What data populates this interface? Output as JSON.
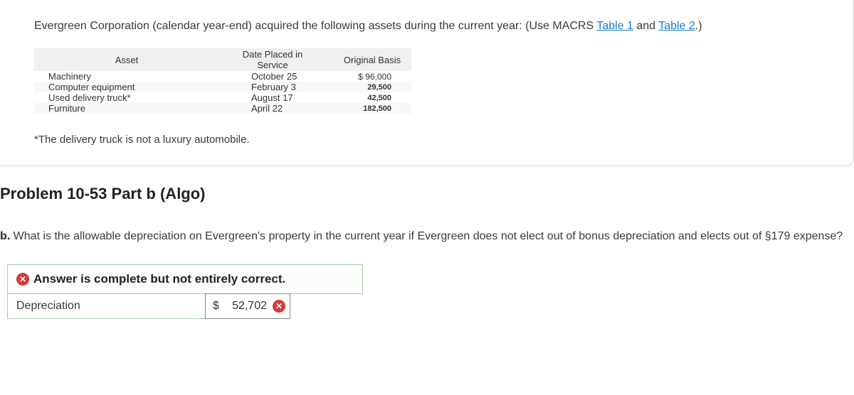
{
  "intro": {
    "prefix": "Evergreen Corporation (calendar year-end) acquired the following assets during the current year: (Use MACRS ",
    "link1": "Table 1",
    "mid": " and ",
    "link2": "Table 2",
    "suffix": ".)"
  },
  "table": {
    "headers": {
      "asset": "Asset",
      "date": "Date Placed in Service",
      "basis": "Original Basis"
    },
    "rows": [
      {
        "asset": "Machinery",
        "date": "October 25",
        "basis": "$ 96,000"
      },
      {
        "asset": "Computer equipment",
        "date": "February 3",
        "basis": "29,500"
      },
      {
        "asset": "Used delivery truck*",
        "date": "August 17",
        "basis": "42,500"
      },
      {
        "asset": "Furniture",
        "date": "April 22",
        "basis": "182,500"
      }
    ]
  },
  "footnote": "*The delivery truck is not a luxury automobile.",
  "problem_heading": "Problem 10-53 Part b (Algo)",
  "question": {
    "part": "b.",
    "text": " What is the allowable depreciation on Evergreen's property in the current year if Evergreen does not elect out of bonus depreciation and elects out of §179 expense?"
  },
  "answer": {
    "banner": "Answer is complete but not entirely correct.",
    "label": "Depreciation",
    "currency": "$",
    "value": "52,702"
  }
}
